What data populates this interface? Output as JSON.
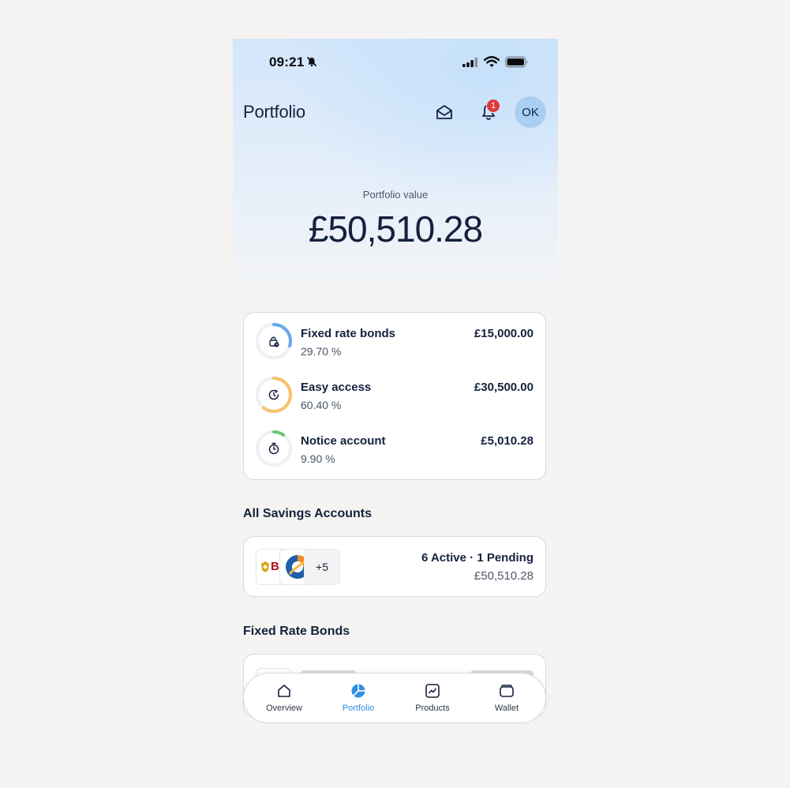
{
  "status_bar": {
    "time": "09:21"
  },
  "header": {
    "title": "Portfolio",
    "notification_count": "1",
    "avatar_initials": "OK"
  },
  "portfolio": {
    "label": "Portfolio value",
    "value": "£50,510.28"
  },
  "breakdown": [
    {
      "name": "Fixed rate bonds",
      "percent_text": "29.70 %",
      "amount": "£15,000.00",
      "fraction": 0.297,
      "color": "#64a9ee",
      "icon": "lock-clock-icon"
    },
    {
      "name": "Easy access",
      "percent_text": "60.40 %",
      "amount": "£30,500.00",
      "fraction": 0.604,
      "color": "#f7c26a",
      "icon": "clock-refresh-icon"
    },
    {
      "name": "Notice account",
      "percent_text": "9.90 %",
      "amount": "£5,010.28",
      "fraction": 0.099,
      "color": "#6cc47c",
      "icon": "stopwatch-icon"
    }
  ],
  "savings_section": {
    "title": "All Savings Accounts",
    "more_count": "+5",
    "status": "6 Active · 1 Pending",
    "amount": "£50,510.28",
    "logo_text": "BI"
  },
  "bonds_section": {
    "title": "Fixed Rate Bonds"
  },
  "tabs": [
    {
      "label": "Overview",
      "icon": "home-icon",
      "active": false
    },
    {
      "label": "Portfolio",
      "icon": "pie-chart-icon",
      "active": true
    },
    {
      "label": "Products",
      "icon": "line-chart-icon",
      "active": false
    },
    {
      "label": "Wallet",
      "icon": "wallet-icon",
      "active": false
    }
  ],
  "colors": {
    "accent": "#2f8ee3",
    "badge": "#e0393e",
    "text": "#14213d",
    "avatar_bg": "#a9cff3"
  }
}
